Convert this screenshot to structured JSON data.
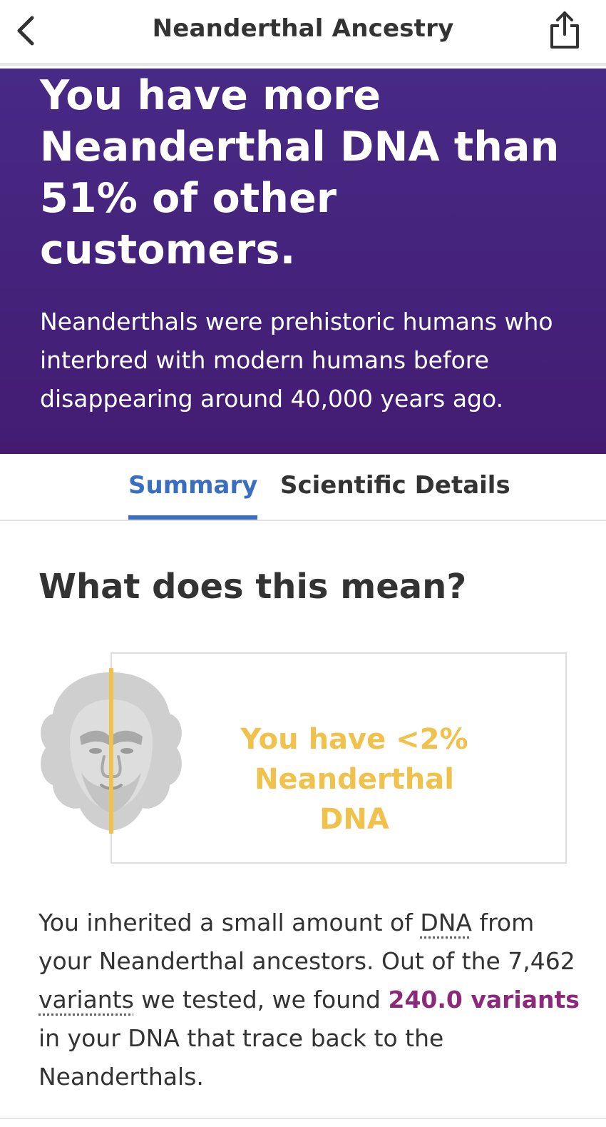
{
  "nav": {
    "title": "Neanderthal Ancestry",
    "back_icon": "chevron-left-icon",
    "share_icon": "share-icon"
  },
  "hero": {
    "title": "You have more Neanderthal DNA than 51% of other customers.",
    "body": "Neanderthals were prehistoric humans who interbred with modern humans before disappearing around 40,000 years ago.",
    "background": "#452378"
  },
  "tabs": [
    {
      "label": "Summary",
      "active": true
    },
    {
      "label": "Scientific Details",
      "active": false
    }
  ],
  "section": {
    "heading": "What does this mean?"
  },
  "card": {
    "illustration_icon": "neanderthal-face-icon",
    "text": "You have <2% Neanderthal DNA",
    "accent_color": "#f0c14b"
  },
  "explanation": {
    "part1": "You inherited a small amount of ",
    "link1": "DNA",
    "part2": " from your Neanderthal ancestors. Out of the 7,462 ",
    "link2": "variants",
    "part3": " we tested, we found ",
    "highlight": "240.0 variants",
    "part4": " in your DNA that trace back to the Neanderthals.",
    "highlight_color": "#8a2a78"
  }
}
